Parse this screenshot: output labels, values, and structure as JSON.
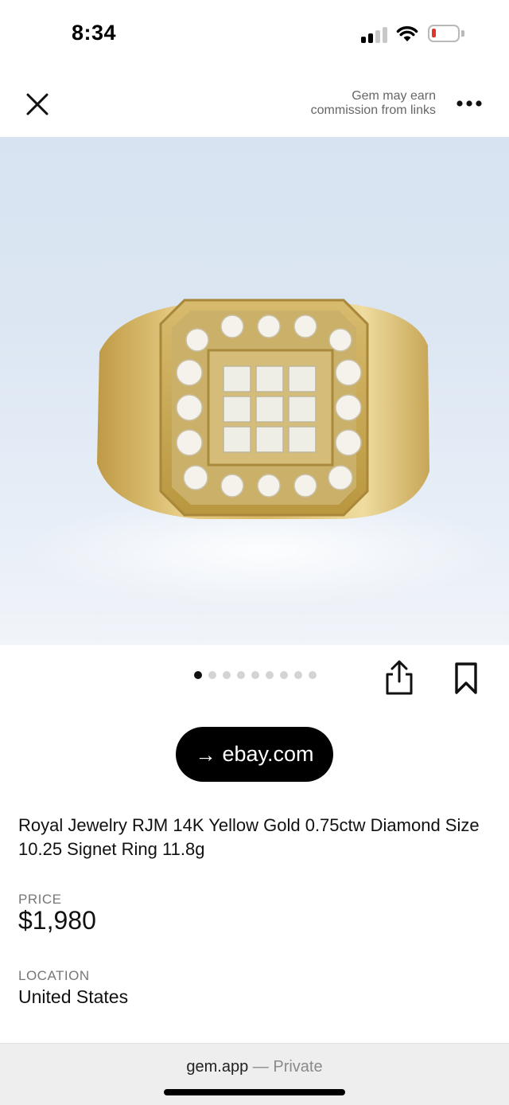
{
  "status_bar": {
    "time": "8:34",
    "battery_color": "#e0362c"
  },
  "header": {
    "close_icon": "close-icon",
    "disclaimer_line1": "Gem may earn",
    "disclaimer_line2": "commission from links",
    "more_icon": "more-horizontal-icon"
  },
  "gallery": {
    "image_subject": "gold diamond signet ring",
    "image_count": 9,
    "active_index": 0
  },
  "actions": {
    "share_icon": "share-icon",
    "bookmark_icon": "bookmark-icon"
  },
  "source": {
    "arrow": "→",
    "label": "ebay.com"
  },
  "product": {
    "title": "Royal Jewelry RJM 14K Yellow Gold 0.75ctw Diamond Size 10.25 Signet Ring 11.8g",
    "price_label": "PRICE",
    "price": "$1,980",
    "location_label": "LOCATION",
    "location": "United States"
  },
  "bottom_bar": {
    "host": "gem.app",
    "separator": " — ",
    "privacy": "Private"
  }
}
